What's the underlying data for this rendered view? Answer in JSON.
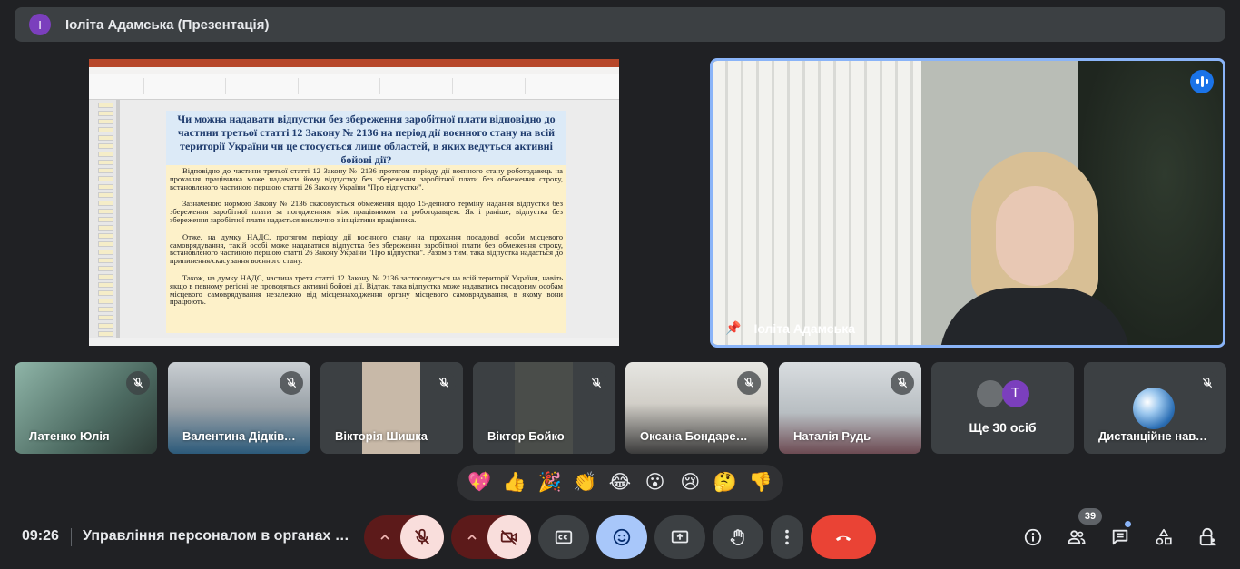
{
  "banner": {
    "avatar_letter": "I",
    "title": "Іоліта Адамська (Презентація)"
  },
  "presentation": {
    "slide_title": "Чи можна надавати відпустки без збереження заробітної плати відповідно до частини третьої статті 12 Закону № 2136 на період дії воєнного стану на всій території України чи це стосується лише областей, в яких ведуться активні бойові дії?",
    "paragraphs": [
      "Відповідно до частини третьої статті 12 Закону № 2136 протягом періоду дії воєнного стану роботодавець на прохання працівника може надавати йому відпустку без збереження заробітної плати без обмеження строку, встановленого частиною першою статті 26 Закону України \"Про відпустки\".",
      "Зазначеною нормою Закону № 2136 скасовуються обмеження щодо 15-денного терміну надання відпустки без збереження заробітної плати за погодженням між працівником та роботодавцем. Як і раніше, відпустка без збереження заробітної плати надається виключно з ініціативи працівника.",
      "Отже, на думку НАДС, протягом періоду дії воєнного стану на прохання посадової особи місцевого самоврядування, такій особі може надаватися відпустка без збереження заробітної плати без обмеження строку, встановленого частиною першою статті 26 Закону України \"Про відпустки\". Разом з тим, така відпустка надається до припинення/скасування воєнного стану.",
      "Також, на думку НАДС, частина третя статті 12 Закону № 2136 застосовується на всій території України, навіть якщо в певному регіоні не проводяться активні бойові дії. Відтак, така відпустка може надаватись посадовим особам місцевого самоврядування незалежно від місцезнаходження органу місцевого самоврядування, в якому вони працюють."
    ]
  },
  "speaker": {
    "name": "Іоліта Адамська"
  },
  "participants": [
    {
      "name": "Латенко Юлія"
    },
    {
      "name": "Валентина Дідківська"
    },
    {
      "name": "Вікторія Шишка"
    },
    {
      "name": "Віктор Бойко"
    },
    {
      "name": "Оксана Бондаренко"
    },
    {
      "name": "Наталія Рудь"
    }
  ],
  "more": {
    "label": "Ще 30 осіб",
    "avatar_letter": "T"
  },
  "last_tile": {
    "name": "Дистанційне навчання"
  },
  "reactions": [
    "💖",
    "👍",
    "🎉",
    "👏",
    "😂",
    "😮",
    "😢",
    "🤔",
    "👎"
  ],
  "footer": {
    "time": "09:26",
    "meeting_title": "Управління персоналом в органах місцевого самоврядування",
    "participants_count": "39"
  },
  "colors": {
    "background": "#202124",
    "active_border": "#8ab4f8",
    "end_call": "#ea4335",
    "muted_control": "#f9dedc",
    "reaction_active": "#a8c7fa"
  }
}
